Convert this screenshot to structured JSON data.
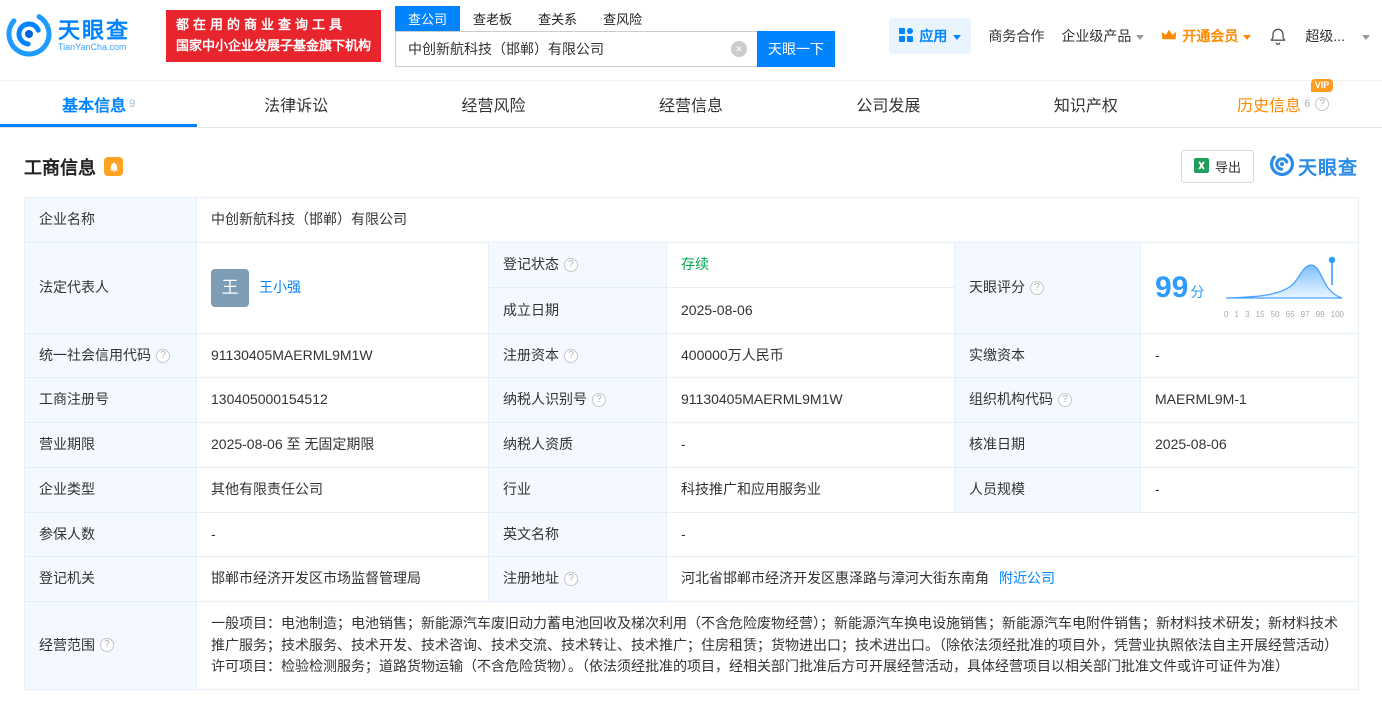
{
  "colors": {
    "brand_blue": "#0084ff",
    "vip_orange": "#ff8a00",
    "status_green": "#00a94f",
    "promo_red": "#e8252d"
  },
  "icons": {
    "help": "?",
    "clear": "✕"
  },
  "header": {
    "logo": {
      "brand": "天眼查",
      "domain": "TianYanCha.com"
    },
    "promo": {
      "line1": "都在用的商业查询工具",
      "line2": "国家中小企业发展子基金旗下机构"
    },
    "search_tabs": {
      "company": "查公司",
      "boss": "查老板",
      "relation": "查关系",
      "risk": "查风险"
    },
    "search": {
      "value": "中创新航科技（邯郸）有限公司",
      "button": "天眼一下"
    },
    "nav": {
      "apps": "应用",
      "cooperation": "商务合作",
      "enterprise": "企业级产品",
      "vip": "开通会员",
      "super": "超级..."
    }
  },
  "tabs": [
    {
      "label": "基本信息",
      "count": "9"
    },
    {
      "label": "法律诉讼"
    },
    {
      "label": "经营风险"
    },
    {
      "label": "经营信息"
    },
    {
      "label": "公司发展"
    },
    {
      "label": "知识产权"
    },
    {
      "label": "历史信息",
      "count": "6",
      "badge": "VIP"
    }
  ],
  "section": {
    "title": "工商信息",
    "export_label": "导出",
    "brand": "天眼查"
  },
  "fields": {
    "company_name": {
      "label": "企业名称",
      "value": "中创新航科技（邯郸）有限公司"
    },
    "legal_rep": {
      "label": "法定代表人",
      "avatar": "王",
      "value": "王小强"
    },
    "reg_status": {
      "label": "登记状态",
      "value": "存续"
    },
    "establish_date": {
      "label": "成立日期",
      "value": "2025-08-06"
    },
    "score": {
      "label": "天眼评分",
      "value": "99",
      "unit": "分",
      "axis": [
        "0",
        "1",
        "3",
        "15",
        "50",
        "65",
        "97",
        "99",
        "100"
      ]
    },
    "credit_code": {
      "label": "统一社会信用代码",
      "value": "91130405MAERML9M1W"
    },
    "reg_capital": {
      "label": "注册资本",
      "value": "400000万人民币"
    },
    "paid_capital": {
      "label": "实缴资本",
      "value": "-"
    },
    "reg_number": {
      "label": "工商注册号",
      "value": "130405000154512"
    },
    "taxpayer_id": {
      "label": "纳税人识别号",
      "value": "91130405MAERML9M1W"
    },
    "org_code": {
      "label": "组织机构代码",
      "value": "MAERML9M-1"
    },
    "business_term": {
      "label": "营业期限",
      "value": "2025-08-06 至 无固定期限"
    },
    "taxpayer_quality": {
      "label": "纳税人资质",
      "value": "-"
    },
    "approval_date": {
      "label": "核准日期",
      "value": "2025-08-06"
    },
    "company_type": {
      "label": "企业类型",
      "value": "其他有限责任公司"
    },
    "industry": {
      "label": "行业",
      "value": "科技推广和应用服务业"
    },
    "staff_size": {
      "label": "人员规模",
      "value": "-"
    },
    "insured_count": {
      "label": "参保人数",
      "value": "-"
    },
    "english_name": {
      "label": "英文名称",
      "value": "-"
    },
    "registry": {
      "label": "登记机关",
      "value": "邯郸市经济开发区市场监督管理局"
    },
    "address": {
      "label": "注册地址",
      "value": "河北省邯郸市经济开发区惠泽路与漳河大街东南角",
      "link": "附近公司"
    },
    "business_scope": {
      "label": "经营范围",
      "value": "一般项目：电池制造；电池销售；新能源汽车废旧动力蓄电池回收及梯次利用（不含危险废物经营）；新能源汽车换电设施销售；新能源汽车电附件销售；新材料技术研发；新材料技术推广服务；技术服务、技术开发、技术咨询、技术交流、技术转让、技术推广；住房租赁；货物进出口；技术进出口。（除依法须经批准的项目外，凭营业执照依法自主开展经营活动）许可项目：检验检测服务；道路货物运输（不含危险货物）。（依法须经批准的项目，经相关部门批准后方可开展经营活动，具体经营项目以相关部门批准文件或许可证件为准）"
    }
  }
}
